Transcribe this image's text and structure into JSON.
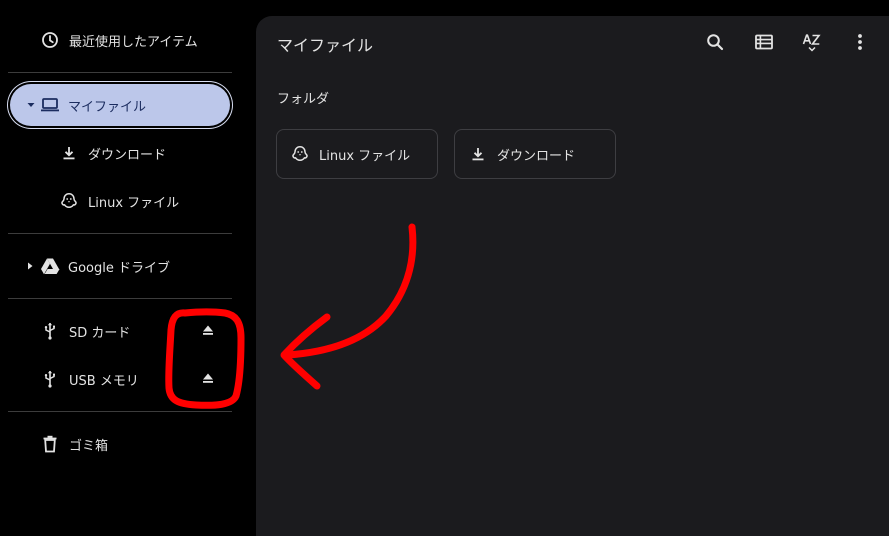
{
  "sidebar": {
    "recent": {
      "label": "最近使用したアイテム",
      "icon": "clock-icon"
    },
    "my_files": {
      "label": "マイファイル",
      "icon": "laptop-icon",
      "expanded": true,
      "selected": true
    },
    "downloads": {
      "label": "ダウンロード",
      "icon": "download-icon"
    },
    "linux_files": {
      "label": "Linux ファイル",
      "icon": "penguin-icon"
    },
    "google_drive": {
      "label": "Google ドライブ",
      "icon": "google-drive-icon"
    },
    "sd_card": {
      "label": "SD カード",
      "icon": "usb-icon",
      "eject_icon": "eject-icon"
    },
    "usb_memory": {
      "label": "USB メモリ",
      "icon": "usb-icon",
      "eject_icon": "eject-icon"
    },
    "trash": {
      "label": "ゴミ箱",
      "icon": "trash-icon"
    }
  },
  "main": {
    "title": "マイファイル",
    "toolbar": {
      "search_icon": "search-icon",
      "view_icon": "list-view-icon",
      "sort_icon": "sort-az-icon",
      "more_icon": "more-vert-icon"
    },
    "section_label": "フォルダ",
    "folders": [
      {
        "label": "Linux ファイル",
        "icon": "penguin-icon"
      },
      {
        "label": "ダウンロード",
        "icon": "download-icon"
      }
    ]
  },
  "annotation": {
    "color": "#ff0000"
  },
  "colors": {
    "background": "#000000",
    "panel": "#1b1b1e",
    "selected_pill": "#bcc7ea",
    "selected_text": "#1b2c5f",
    "text": "#e3e3e3"
  }
}
